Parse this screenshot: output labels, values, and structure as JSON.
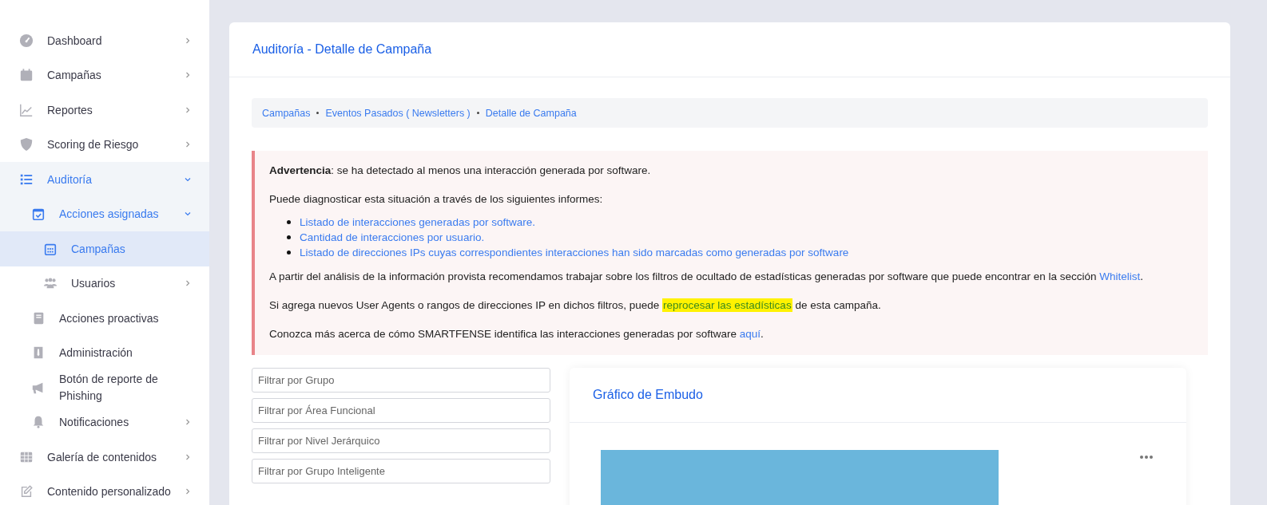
{
  "sidebar": {
    "items": [
      {
        "label": "Dashboard",
        "selected": false,
        "expanded": false
      },
      {
        "label": "Campañas",
        "selected": false,
        "expanded": false
      },
      {
        "label": "Reportes",
        "selected": false,
        "expanded": false
      },
      {
        "label": "Scoring de Riesgo",
        "selected": false,
        "expanded": false
      },
      {
        "label": "Auditoría",
        "selected": false,
        "expanded": true,
        "children": [
          {
            "label": "Acciones asignadas",
            "selected": false,
            "expanded": true,
            "children": [
              {
                "label": "Campañas",
                "selected": true
              },
              {
                "label": "Usuarios",
                "selected": false,
                "expanded": false
              }
            ]
          },
          {
            "label": "Acciones proactivas",
            "selected": false
          },
          {
            "label": "Administración",
            "selected": false
          },
          {
            "label": "Botón de reporte de Phishing",
            "selected": false
          },
          {
            "label": "Notificaciones",
            "selected": false,
            "expanded": false
          }
        ]
      },
      {
        "label": "Galería de contenidos",
        "selected": false,
        "expanded": false
      },
      {
        "label": "Contenido personalizado",
        "selected": false,
        "expanded": false
      }
    ]
  },
  "page": {
    "title": "Auditoría - Detalle de Campaña",
    "breadcrumb": [
      "Campañas",
      "Eventos Pasados ( Newsletters )",
      "Detalle de Campaña"
    ],
    "warning": {
      "paragraphs": [
        [
          {
            "kind": "bold",
            "text": "Advertencia"
          },
          {
            "kind": "text",
            "text": ": se ha detectado al menos una interacción generada por software."
          }
        ],
        [
          {
            "kind": "text",
            "text": "Puede diagnosticar esta situación a través de los siguientes informes:"
          }
        ]
      ],
      "links": [
        "Listado de interacciones generadas por software.",
        "Cantidad de interacciones por usuario.",
        "Listado de direcciones IPs cuyas correspondientes interacciones han sido marcadas como generadas por software"
      ],
      "paragraphs_after": [
        [
          {
            "kind": "text",
            "text": "A partir del análisis de la información provista recomendamos trabajar sobre los filtros de ocultado de estadísticas generadas por software que puede encontrar en la sección "
          },
          {
            "kind": "link",
            "text": "Whitelist"
          },
          {
            "kind": "text",
            "text": "."
          }
        ],
        [
          {
            "kind": "text",
            "text": "Si agrega nuevos User Agents o rangos de direcciones IP en dichos filtros, puede "
          },
          {
            "kind": "highlight",
            "text": "reprocesar las estadísticas"
          },
          {
            "kind": "text",
            "text": " de esta campaña."
          }
        ],
        [
          {
            "kind": "text",
            "text": "Conozca más acerca de cómo SMARTFENSE identifica las interacciones generadas por software "
          },
          {
            "kind": "link",
            "text": "aquí"
          },
          {
            "kind": "text",
            "text": "."
          }
        ]
      ]
    },
    "filters": [
      {
        "placeholder": "Filtrar por Grupo"
      },
      {
        "placeholder": "Filtrar por Área Funcional"
      },
      {
        "placeholder": "Filtrar por Nivel Jerárquico"
      },
      {
        "placeholder": "Filtrar por Grupo Inteligente"
      }
    ],
    "chart_card": {
      "title": "Gráfico de Embudo"
    }
  }
}
